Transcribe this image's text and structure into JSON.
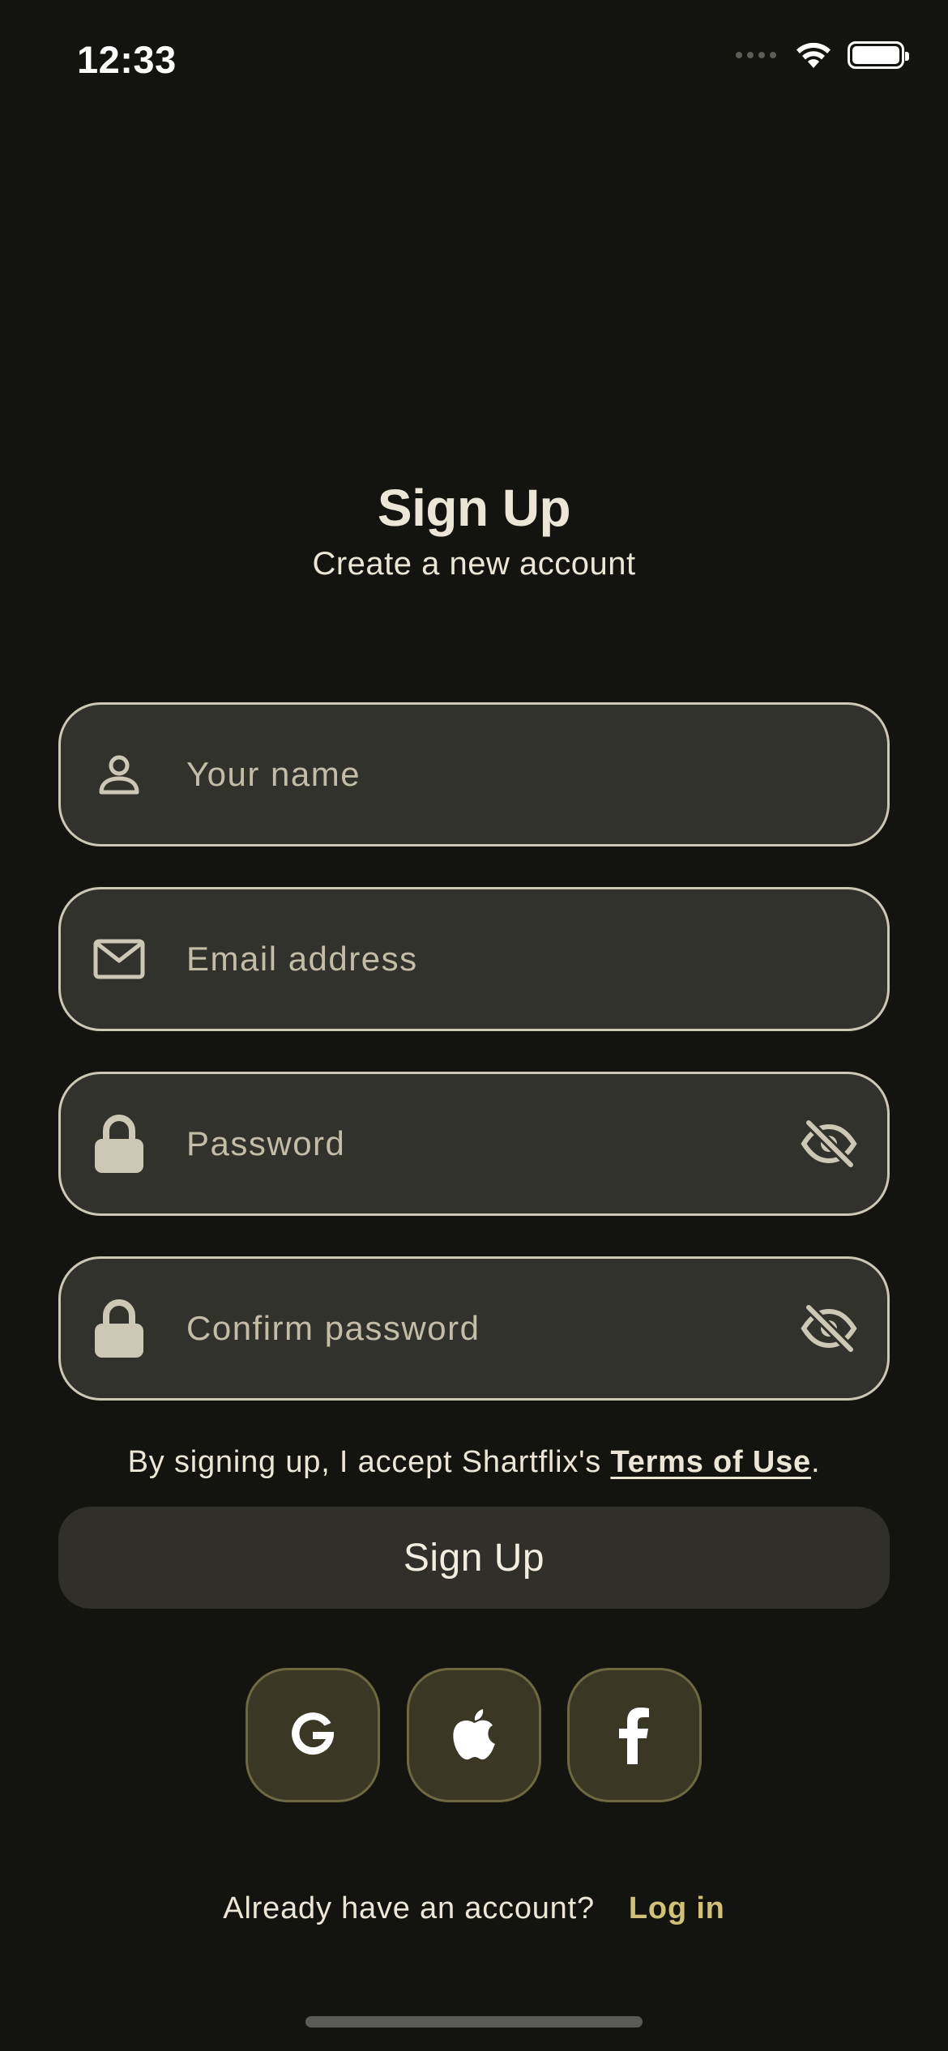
{
  "status_bar": {
    "time": "12:33"
  },
  "header": {
    "title": "Sign Up",
    "subtitle": "Create a new account"
  },
  "form": {
    "name": {
      "value": "",
      "placeholder": "Your name",
      "icon": "person-icon"
    },
    "email": {
      "value": "",
      "placeholder": "Email address",
      "icon": "mail-icon"
    },
    "password": {
      "value": "",
      "placeholder": "Password",
      "icon": "lock-icon",
      "toggle_icon": "eye-off-icon"
    },
    "confirm_password": {
      "value": "",
      "placeholder": "Confirm password",
      "icon": "lock-icon",
      "toggle_icon": "eye-off-icon"
    }
  },
  "terms": {
    "prefix": "By signing up, I accept Shartflix's ",
    "link": "Terms of Use",
    "suffix": "."
  },
  "signup_button": {
    "label": "Sign Up"
  },
  "social": [
    {
      "provider": "google",
      "icon": "google-icon"
    },
    {
      "provider": "apple",
      "icon": "apple-icon"
    },
    {
      "provider": "facebook",
      "icon": "facebook-icon"
    }
  ],
  "footer": {
    "question": "Already have an account?",
    "login_link": "Log in"
  },
  "colors": {
    "background": "#13130f",
    "field_background": "#32322c",
    "field_border": "#cdc8b6",
    "text": "#ece6d6",
    "accent": "#d0c078",
    "social_background": "#3a3725",
    "social_border": "#6d6841"
  }
}
